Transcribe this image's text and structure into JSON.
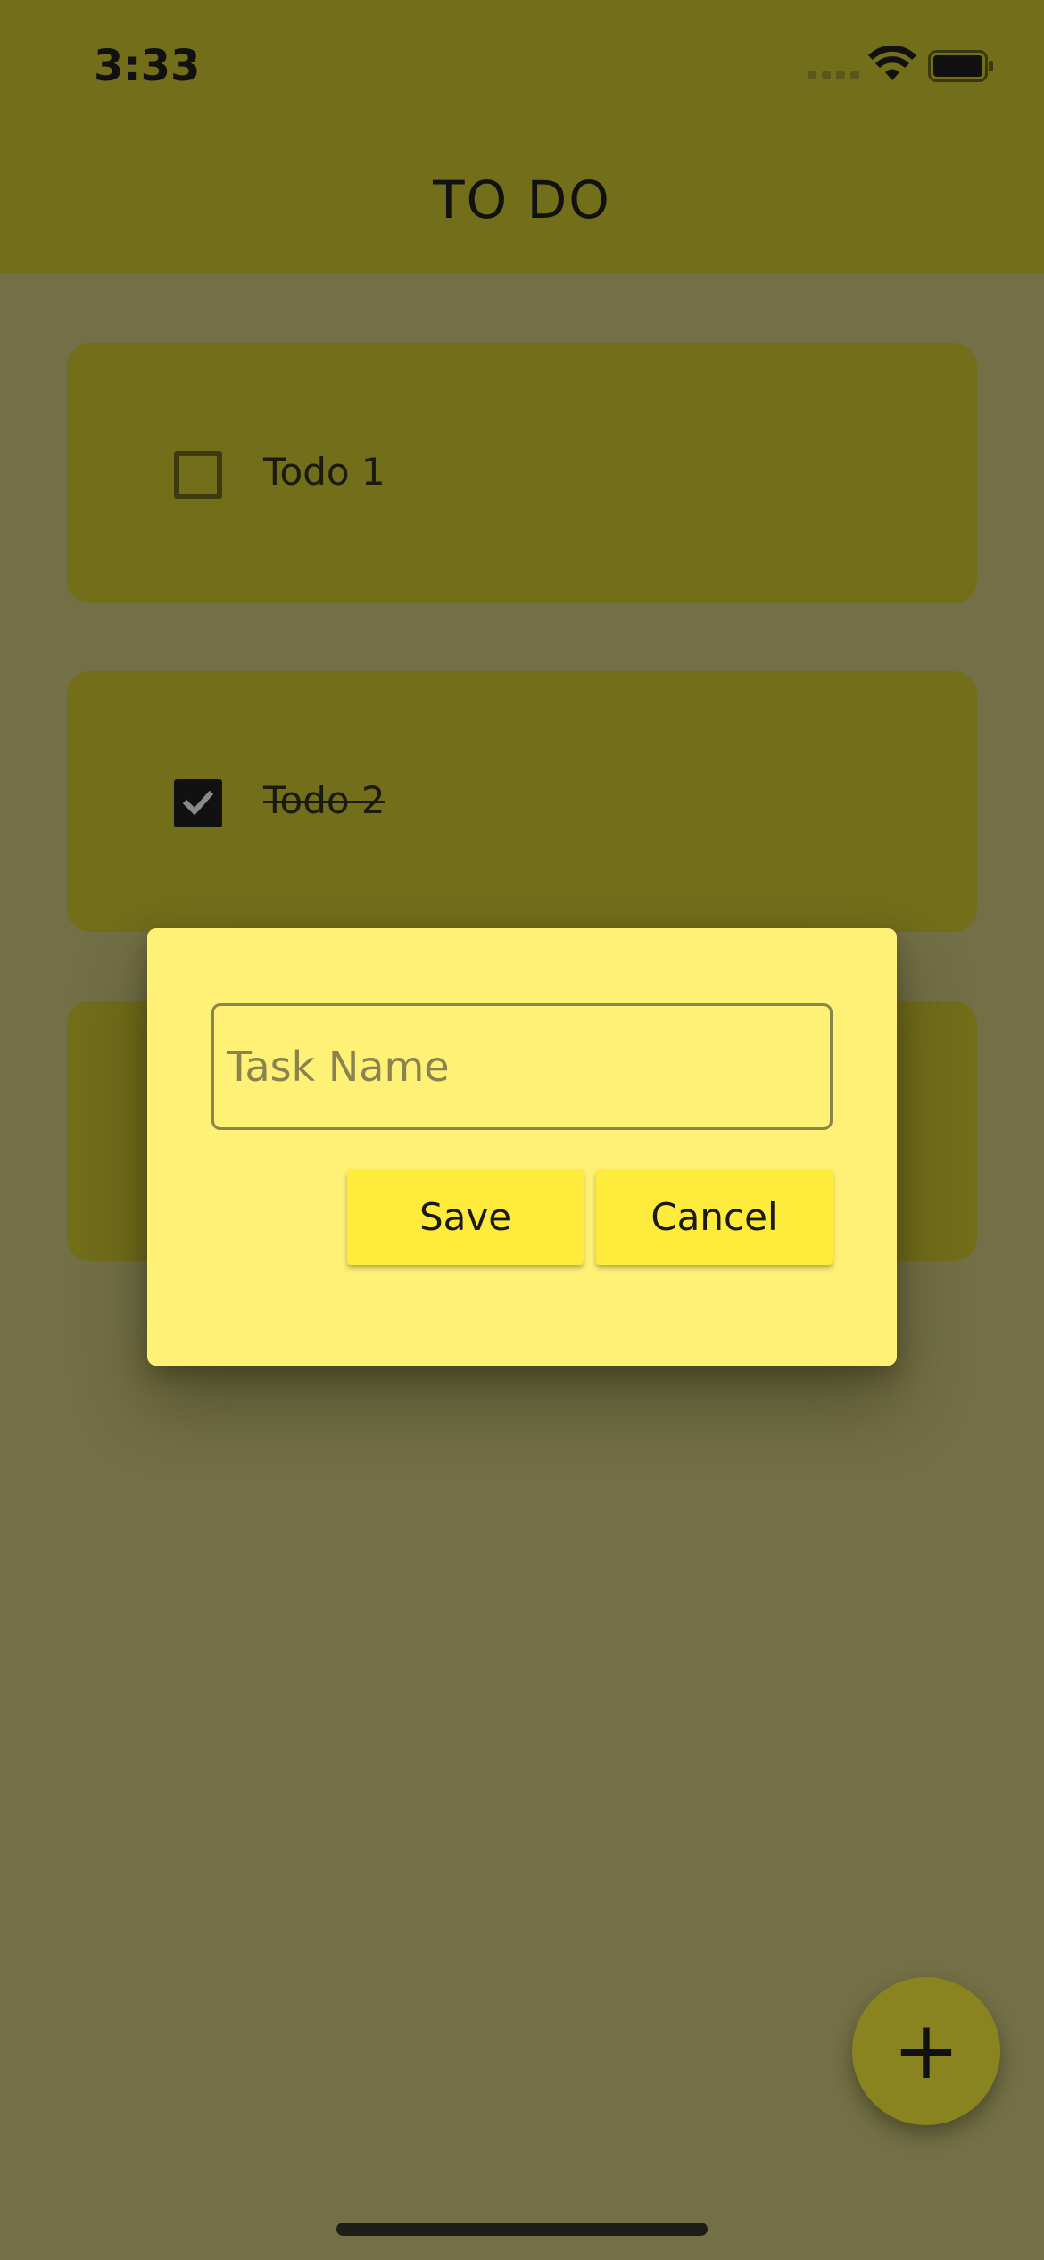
{
  "status_bar": {
    "time": "3:33"
  },
  "app_bar": {
    "title": "TO DO"
  },
  "todos": [
    {
      "label": "Todo 1",
      "done": false
    },
    {
      "label": "Todo 2",
      "done": true
    },
    {
      "label": "",
      "done": false
    }
  ],
  "dialog": {
    "input_placeholder": "Task Name",
    "input_value": "",
    "save_label": "Save",
    "cancel_label": "Cancel"
  },
  "fab": {
    "label": "+"
  },
  "colors": {
    "app_bar": "#736e1a",
    "dialog_background": "#fff176",
    "button": "#ffeb3b",
    "scrim_background": "#737047"
  }
}
